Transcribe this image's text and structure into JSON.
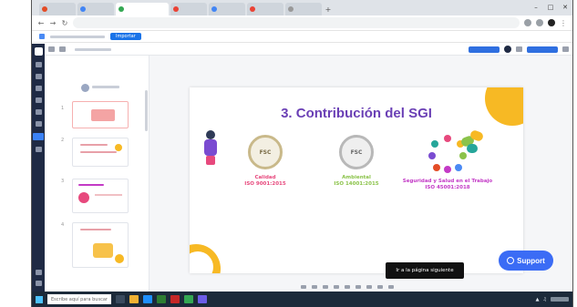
{
  "browser": {
    "tabs": [
      {
        "label": "",
        "active": false,
        "color": "#e34c26"
      },
      {
        "label": "",
        "active": false,
        "color": "#4285f4"
      },
      {
        "label": "",
        "active": true,
        "color": "#34a853"
      },
      {
        "label": "",
        "active": false,
        "color": "#ea4335"
      },
      {
        "label": "",
        "active": false,
        "color": "#4285f4"
      },
      {
        "label": "",
        "active": false,
        "color": "#ea4335"
      },
      {
        "label": "",
        "active": false,
        "color": "#999999"
      }
    ],
    "url": "",
    "bookmark_button": "Importar"
  },
  "app": {
    "topbar": {
      "left_link": "",
      "right_btn_1": "",
      "right_btn_2": ""
    },
    "slide": {
      "title": "3. Contribución del SGI",
      "columns": [
        {
          "seal": "FSC",
          "label": "Calidad\nISO 9001:2015",
          "label_color": "#e7497d",
          "body": ""
        },
        {
          "seal": "FSC",
          "label": "Ambiental\nISO 14001:2015",
          "label_color": "#8bc34a",
          "body": ""
        },
        {
          "label": "Seguridad y Salud en el Trabajo\nISO 45001:2018",
          "label_color": "#c33ac6",
          "body": ""
        }
      ]
    },
    "tooltip": "Ir a la página siguiente",
    "support_label": "Support"
  },
  "taskbar": {
    "search_placeholder": "Escribe aquí para buscar"
  },
  "colors": {
    "accent": "#3b6cf5",
    "title": "#6a3fb5",
    "yellow": "#f7b924",
    "rail": "#1f2a44"
  }
}
